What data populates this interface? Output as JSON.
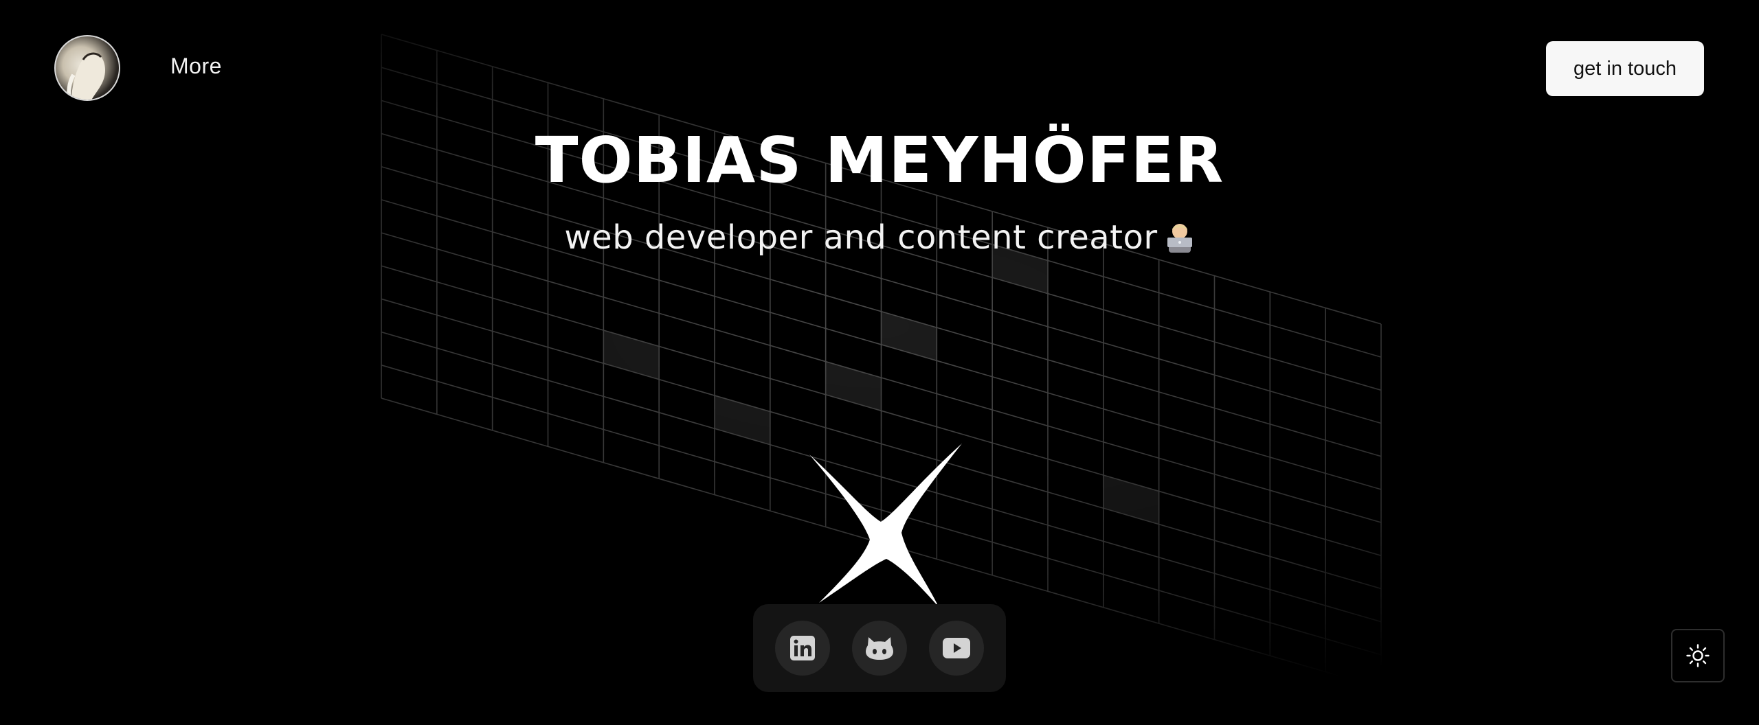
{
  "header": {
    "nav_more_label": "More",
    "cta_label": "get in touch"
  },
  "hero": {
    "title": "TOBIAS MEYHÖFER",
    "subtitle": "web developer and content creator"
  },
  "socials": [
    {
      "name": "LinkedIn",
      "icon": "linkedin-icon"
    },
    {
      "name": "GitHub",
      "icon": "github-icon"
    },
    {
      "name": "YouTube",
      "icon": "youtube-icon"
    }
  ],
  "theme_toggle": {
    "icon": "sun-icon"
  },
  "colors": {
    "background": "#000000",
    "text": "#ffffff",
    "cta_background": "#f7f7f7",
    "dock_background": "#141414",
    "social_button_background": "#262626",
    "social_icon": "#d4d4d4"
  }
}
